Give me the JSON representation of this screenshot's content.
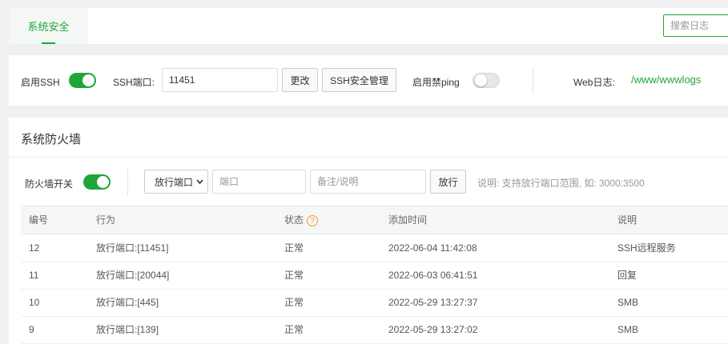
{
  "tabs": {
    "active": "系统安全"
  },
  "search": {
    "placeholder": "搜索日志"
  },
  "ssh": {
    "enable_label": "启用SSH",
    "enabled": true,
    "port_label": "SSH端口:",
    "port_value": "11451",
    "change_button": "更改",
    "manage_button": "SSH安全管理",
    "ping_label": "启用禁ping",
    "ping_enabled": false,
    "weblog_label": "Web日志:",
    "weblog_path": "/www/wwwlogs"
  },
  "firewall": {
    "title": "系统防火墙",
    "switch_label": "防火墙开关",
    "switch_enabled": true,
    "select_value": "放行端口",
    "port_placeholder": "端口",
    "note_placeholder": "备注/说明",
    "allow_button": "放行",
    "hint": "说明: 支持放行端口范围, 如: 3000:3500",
    "columns": [
      "编号",
      "行为",
      "状态",
      "添加时间",
      "说明"
    ],
    "status_help_icon": "?",
    "rows": [
      {
        "id": "12",
        "action": "放行端口:[11451]",
        "status": "正常",
        "time": "2022-06-04 11:42:08",
        "note": "SSH远程服务"
      },
      {
        "id": "11",
        "action": "放行端口:[20044]",
        "status": "正常",
        "time": "2022-06-03 06:41:51",
        "note": "回复"
      },
      {
        "id": "10",
        "action": "放行端口:[445]",
        "status": "正常",
        "time": "2022-05-29 13:27:37",
        "note": "SMB"
      },
      {
        "id": "9",
        "action": "放行端口:[139]",
        "status": "正常",
        "time": "2022-05-29 13:27:02",
        "note": "SMB"
      }
    ]
  },
  "colors": {
    "accent": "#20a53a",
    "help": "#f0a020"
  }
}
